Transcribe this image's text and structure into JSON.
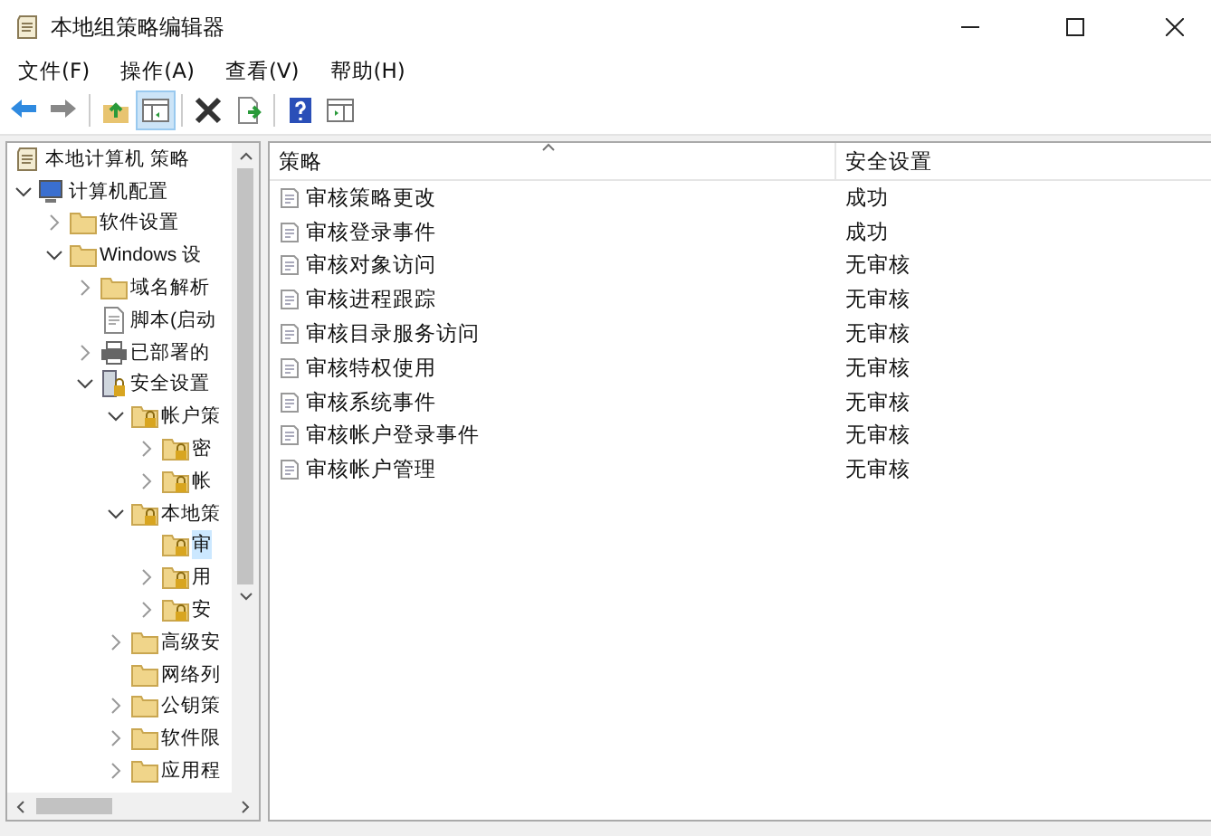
{
  "window": {
    "title": "本地组策略编辑器"
  },
  "menu": [
    {
      "label": "文件(F)"
    },
    {
      "label": "操作(A)"
    },
    {
      "label": "查看(V)"
    },
    {
      "label": "帮助(H)"
    }
  ],
  "toolbar": [
    {
      "kind": "back",
      "pressed": false
    },
    {
      "kind": "forward",
      "pressed": false
    },
    {
      "kind": "separator"
    },
    {
      "kind": "up",
      "pressed": false
    },
    {
      "kind": "tree",
      "pressed": true
    },
    {
      "kind": "separator"
    },
    {
      "kind": "delete",
      "pressed": false
    },
    {
      "kind": "export",
      "pressed": false
    },
    {
      "kind": "separator"
    },
    {
      "kind": "help",
      "pressed": false
    },
    {
      "kind": "pane",
      "pressed": false
    }
  ],
  "tree": [
    {
      "label": "本地计算机 策略",
      "kind": "policy",
      "selected": false,
      "children": [
        {
          "label": "计算机配置",
          "kind": "computer",
          "expanded": true,
          "selected": false,
          "children": [
            {
              "label": "软件设置",
              "kind": "folder",
              "expanded": false,
              "selected": false
            },
            {
              "label": "Windows 设",
              "kind": "folder",
              "expanded": true,
              "selected": false,
              "children": [
                {
                  "label": "域名解析",
                  "kind": "folder",
                  "expanded": false,
                  "selected": false
                },
                {
                  "label": "脚本(启动",
                  "kind": "script",
                  "selected": false
                },
                {
                  "label": "已部署的",
                  "kind": "printer",
                  "expanded": false,
                  "selected": false
                },
                {
                  "label": "安全设置",
                  "kind": "security",
                  "expanded": true,
                  "selected": false,
                  "children": [
                    {
                      "label": "帐户策",
                      "kind": "lock-folder",
                      "expanded": true,
                      "selected": false,
                      "children": [
                        {
                          "label": "密",
                          "kind": "lock-folder",
                          "expanded": false,
                          "selected": false
                        },
                        {
                          "label": "帐",
                          "kind": "lock-folder",
                          "expanded": false,
                          "selected": false
                        }
                      ]
                    },
                    {
                      "label": "本地策",
                      "kind": "lock-folder",
                      "expanded": true,
                      "selected": false,
                      "children": [
                        {
                          "label": "审",
                          "kind": "lock-folder",
                          "selected": true
                        },
                        {
                          "label": "用",
                          "kind": "lock-folder",
                          "expanded": false,
                          "selected": false
                        },
                        {
                          "label": "安",
                          "kind": "lock-folder",
                          "expanded": false,
                          "selected": false
                        }
                      ]
                    },
                    {
                      "label": "高级安",
                      "kind": "folder",
                      "expanded": false,
                      "selected": false
                    },
                    {
                      "label": "网络列",
                      "kind": "folder",
                      "selected": false
                    },
                    {
                      "label": "公钥策",
                      "kind": "folder",
                      "expanded": false,
                      "selected": false
                    },
                    {
                      "label": "软件限",
                      "kind": "folder",
                      "expanded": false,
                      "selected": false
                    },
                    {
                      "label": "应用程",
                      "kind": "folder",
                      "expanded": false,
                      "selected": false
                    }
                  ]
                }
              ]
            }
          ]
        }
      ]
    }
  ],
  "table": {
    "columns": [
      {
        "label": "策略",
        "sorted": true
      },
      {
        "label": "安全设置",
        "sorted": false
      }
    ],
    "rows": [
      [
        "审核策略更改",
        "成功"
      ],
      [
        "审核登录事件",
        "成功"
      ],
      [
        "审核对象访问",
        "无审核"
      ],
      [
        "审核进程跟踪",
        "无审核"
      ],
      [
        "审核目录服务访问",
        "无审核"
      ],
      [
        "审核特权使用",
        "无审核"
      ],
      [
        "审核系统事件",
        "无审核"
      ],
      [
        "审核帐户登录事件",
        "无审核"
      ],
      [
        "审核帐户管理",
        "无审核"
      ]
    ]
  }
}
